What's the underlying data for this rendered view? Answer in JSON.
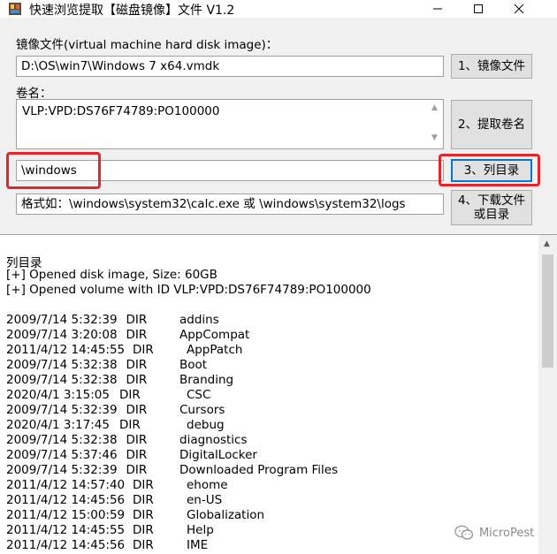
{
  "window": {
    "title": "快速浏览提取【磁盘镜像】文件 V1.2"
  },
  "image_file": {
    "label": "镜像文件(virtual machine hard disk image)：",
    "value": "D:\\OS\\win7\\Windows 7 x64.vmdk",
    "button": "1、镜像文件"
  },
  "volume": {
    "label": "卷名：",
    "value": "VLP:VPD:DS76F74789:PO100000",
    "button": "2、提取卷名"
  },
  "path": {
    "value": "\\windows",
    "button": "3、列目录"
  },
  "format": {
    "hint": "格式如：\\windows\\system32\\calc.exe 或 \\windows\\system32\\logs",
    "button_line1": "4、下载文件",
    "button_line2": "或目录"
  },
  "output": {
    "heading": "列目录",
    "log": [
      "[+] Opened disk image, Size: 60GB",
      "[+] Opened volume with ID VLP:VPD:DS76F74789:PO100000"
    ],
    "entries": [
      {
        "date": "2009/7/14 5:32:39",
        "type": "DIR",
        "name": "addins"
      },
      {
        "date": "2009/7/14 3:20:08",
        "type": "DIR",
        "name": "AppCompat"
      },
      {
        "date": "2011/4/12 14:45:55",
        "type": "DIR",
        "name": "AppPatch"
      },
      {
        "date": "2009/7/14 5:32:38",
        "type": "DIR",
        "name": "Boot"
      },
      {
        "date": "2009/7/14 5:32:38",
        "type": "DIR",
        "name": "Branding"
      },
      {
        "date": "2020/4/1 3:15:05",
        "type": "DIR",
        "name": "CSC"
      },
      {
        "date": "2009/7/14 5:32:39",
        "type": "DIR",
        "name": "Cursors"
      },
      {
        "date": "2020/4/1 3:17:45",
        "type": "DIR",
        "name": "debug"
      },
      {
        "date": "2009/7/14 5:32:38",
        "type": "DIR",
        "name": "diagnostics"
      },
      {
        "date": "2009/7/14 5:37:46",
        "type": "DIR",
        "name": "DigitalLocker"
      },
      {
        "date": "2009/7/14 5:32:39",
        "type": "DIR",
        "name": "Downloaded Program Files"
      },
      {
        "date": "2011/4/12 14:57:40",
        "type": "DIR",
        "name": "ehome"
      },
      {
        "date": "2011/4/12 14:45:56",
        "type": "DIR",
        "name": "en-US"
      },
      {
        "date": "2011/4/12 15:00:59",
        "type": "DIR",
        "name": "Globalization"
      },
      {
        "date": "2011/4/12 14:45:55",
        "type": "DIR",
        "name": "Help"
      },
      {
        "date": "2011/4/12 14:45:56",
        "type": "DIR",
        "name": "IME"
      }
    ]
  },
  "watermark": {
    "text": "MicroPest"
  },
  "icons": {
    "app": "app-icon",
    "minimize": "minimize-icon",
    "maximize": "maximize-icon",
    "close": "close-icon"
  }
}
